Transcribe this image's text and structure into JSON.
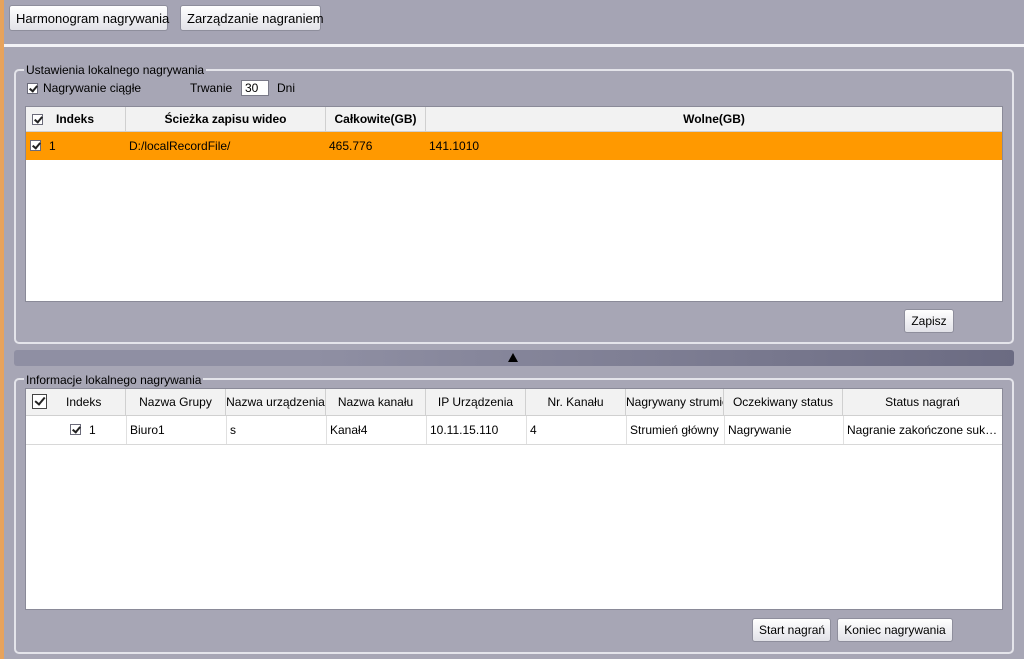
{
  "tabs": {
    "schedule_label": "Harmonogram nagrywania",
    "management_label": "Zarządzanie nagraniem"
  },
  "settings": {
    "group_title": "Ustawienia lokalnego nagrywania",
    "continuous_label": "Nagrywanie ciągłe",
    "continuous_checked": true,
    "duration_label": "Trwanie",
    "duration_value": "30",
    "duration_unit": "Dni",
    "columns": [
      "Indeks",
      "Ścieżka zapisu wideo",
      "Całkowite(GB)",
      "Wolne(GB)"
    ],
    "rows": [
      {
        "index": "1",
        "path": "D:/localRecordFile/",
        "total": "465.776",
        "free": "141.1010",
        "checked": true
      }
    ],
    "save_label": "Zapisz"
  },
  "info": {
    "group_title": "Informacje lokalnego nagrywania",
    "columns": [
      "Indeks",
      "Nazwa Grupy",
      "Nazwa urządzenia",
      "Nazwa kanału",
      "IP Urządzenia",
      "Nr. Kanału",
      "Nagrywany strumień",
      "Oczekiwany status",
      "Status nagrań"
    ],
    "rows": [
      {
        "index": "1",
        "group": "Biuro1",
        "device": "s",
        "channel_name": "Kanał4",
        "ip": "10.11.15.110",
        "channel_no": "4",
        "stream": "Strumień główny",
        "expected": "Nagrywanie",
        "status": "Nagranie zakończone sukcesem",
        "checked": true
      }
    ],
    "start_label": "Start nagrań",
    "stop_label": "Koniec nagrywania"
  },
  "icons": {
    "splitter_arrow": "triangle-up-icon"
  },
  "colors": {
    "background": "#a7a6b5",
    "selected_row": "#ff9900",
    "left_accent": "#e7a35c"
  }
}
